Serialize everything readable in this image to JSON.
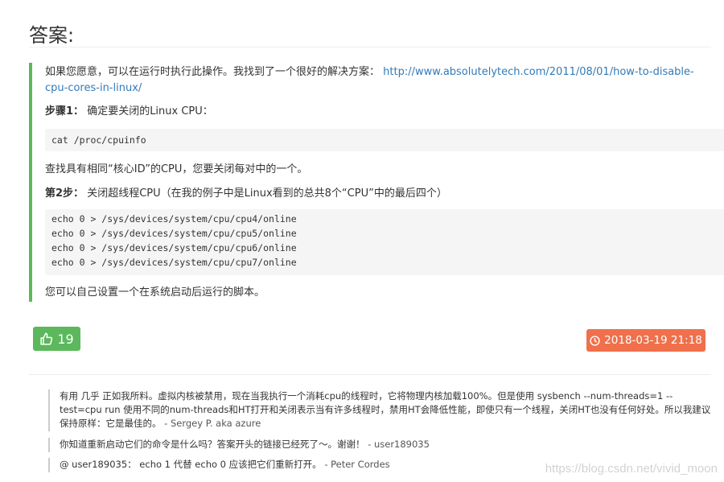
{
  "title": "答案:",
  "answer": {
    "intro_text": "如果您愿意，可以在运行时执行此操作。我找到了一个很好的解决方案：",
    "link_text": "http://www.absolutelytech.com/2011/08/01/how-to-disable-cpu-cores-in-linux/",
    "step1_label": "步骤1：",
    "step1_text": "确定要关闭的Linux CPU：",
    "code1": "cat /proc/cpuinfo",
    "find_text": "查找具有相同“核心ID”的CPU，您要关闭每对中的一个。",
    "step2_label": "第2步：",
    "step2_text": "关闭超线程CPU（在我的例子中是Linux看到的总共8个“CPU”中的最后四个）",
    "code2": [
      "echo 0 > /sys/devices/system/cpu/cpu4/online",
      "echo 0 > /sys/devices/system/cpu/cpu5/online",
      "echo 0 > /sys/devices/system/cpu/cpu6/online",
      "echo 0 > /sys/devices/system/cpu/cpu7/online"
    ],
    "final_text": "您可以自己设置一个在系统启动后运行的脚本。"
  },
  "vote_count": "19",
  "date": "2018-03-19 21:18",
  "comments": [
    {
      "text": "有用 几乎 正如我所料。虚拟内核被禁用，现在当我执行一个消耗cpu的线程时，它将物理内核加载100%。但是使用 sysbench --num-threads=1 --test=cpu run 使用不同的num-threads和HT打开和关闭表示当有许多线程时，禁用HT会降低性能，即使只有一个线程，关闭HT也没有任何好处。所以我建议保持原样：它是最佳的。",
      "author": "- Sergey P. aka azure"
    },
    {
      "text": "你知道重新启动它们的命令是什么吗？答案开头的链接已经死了〜。谢谢！",
      "author": "- user189035"
    },
    {
      "text": "@ user189035： echo 1 代替 echo 0 应该把它们重新打开。",
      "author": "- Peter Cordes"
    }
  ],
  "watermark": "https://blog.csdn.net/vivid_moon",
  "colors": {
    "accent_green": "#5cb85c",
    "date_orange": "#f0704b",
    "link_blue": "#337ab7"
  },
  "icons": {
    "vote": "thumbs-up-icon",
    "date": "clock-icon"
  }
}
